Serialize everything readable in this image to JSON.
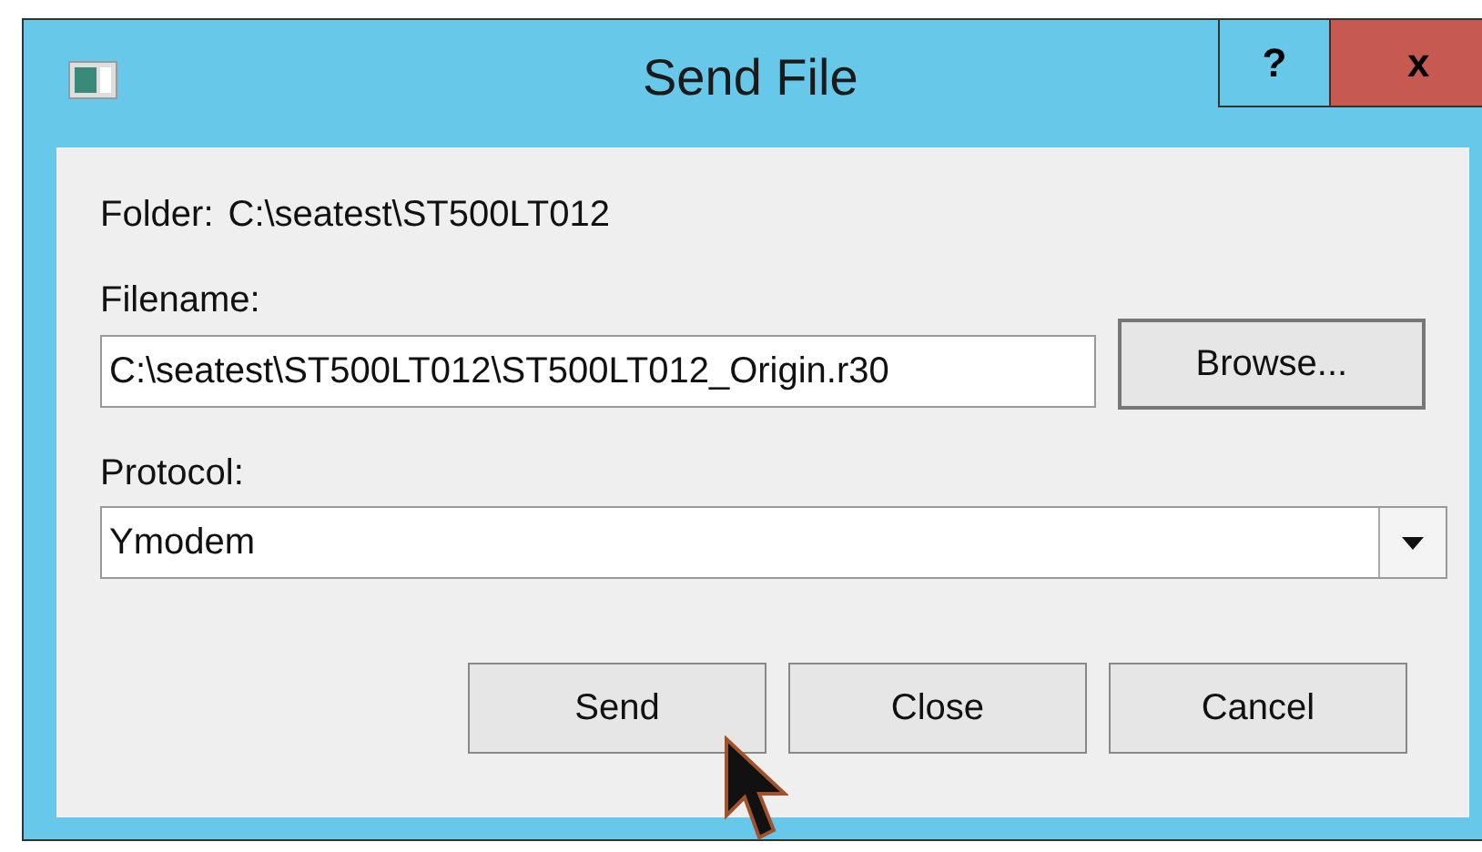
{
  "window": {
    "title": "Send File",
    "help_button": "?",
    "close_button": "x"
  },
  "folder": {
    "label": "Folder:",
    "value": "C:\\seatest\\ST500LT012"
  },
  "filename": {
    "label": "Filename:",
    "value": "C:\\seatest\\ST500LT012\\ST500LT012_Origin.r30"
  },
  "browse_button": "Browse...",
  "protocol": {
    "label": "Protocol:",
    "value": "Ymodem"
  },
  "buttons": [
    "Send",
    "Close",
    "Cancel"
  ]
}
